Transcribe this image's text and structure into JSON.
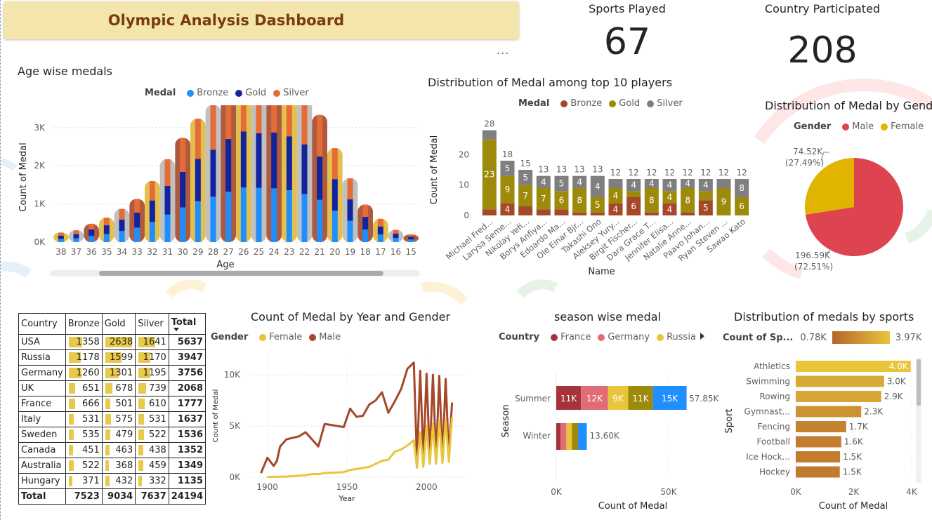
{
  "header": {
    "title": "Olympic Analysis Dashboard",
    "more_label": "..."
  },
  "kpis": [
    {
      "label": "Sports Played",
      "value": "67"
    },
    {
      "label": "Country Participated",
      "value": "208"
    }
  ],
  "colors": {
    "bronze_age": "#1f8fff",
    "gold_age": "#12239e",
    "silver_age": "#e66c37",
    "bronze": "#a5482a",
    "gold": "#9e8a0a",
    "silver": "#7f7f7f",
    "male": "#de4350",
    "female": "#e0b400",
    "line_male": "#a5482a",
    "line_female": "#e8c53a",
    "france": "#a4343a",
    "germany": "#e06c75",
    "russia": "#e8c53a"
  },
  "age_chart": {
    "title": "Age wise medals",
    "legend_title": "Medal",
    "legend": [
      "Bronze",
      "Gold",
      "Silver"
    ],
    "ylabel": "Count of Medal",
    "xlabel": "Age",
    "y_ticks": [
      "0K",
      "1K",
      "2K",
      "3K"
    ]
  },
  "players_chart": {
    "title": "Distribution of Medal among top 10 players",
    "legend_title": "Medal",
    "legend": [
      "Bronze",
      "Gold",
      "Silver"
    ],
    "ylabel": "Count of Medal",
    "xlabel": "Name",
    "y_ticks": [
      "0",
      "10",
      "20"
    ]
  },
  "gender_pie": {
    "title": "Distribution of Medal by Gender",
    "legend_title": "Gender",
    "legend": [
      "Male",
      "Female"
    ],
    "labels": [
      {
        "line1": "74.52K",
        "line2": "(27.49%)"
      },
      {
        "line1": "196.59K",
        "line2": "(72.51%)"
      }
    ]
  },
  "medal_table": {
    "headers": [
      "Country",
      "Bronze",
      "Gold",
      "Silver",
      "Total"
    ],
    "rows": [
      {
        "country": "USA",
        "bronze": "1358",
        "gold": "2638",
        "silver": "1641",
        "total": "5637"
      },
      {
        "country": "Russia",
        "bronze": "1178",
        "gold": "1599",
        "silver": "1170",
        "total": "3947"
      },
      {
        "country": "Germany",
        "bronze": "1260",
        "gold": "1301",
        "silver": "1195",
        "total": "3756"
      },
      {
        "country": "UK",
        "bronze": "651",
        "gold": "678",
        "silver": "739",
        "total": "2068"
      },
      {
        "country": "France",
        "bronze": "666",
        "gold": "501",
        "silver": "610",
        "total": "1777"
      },
      {
        "country": "Italy",
        "bronze": "531",
        "gold": "575",
        "silver": "531",
        "total": "1637"
      },
      {
        "country": "Sweden",
        "bronze": "535",
        "gold": "479",
        "silver": "522",
        "total": "1536"
      },
      {
        "country": "Canada",
        "bronze": "451",
        "gold": "463",
        "silver": "438",
        "total": "1352"
      },
      {
        "country": "Australia",
        "bronze": "522",
        "gold": "368",
        "silver": "459",
        "total": "1349"
      },
      {
        "country": "Hungary",
        "bronze": "371",
        "gold": "432",
        "silver": "332",
        "total": "1135"
      }
    ],
    "totals": {
      "label": "Total",
      "bronze": "7523",
      "gold": "9034",
      "silver": "7637",
      "total": "24194"
    }
  },
  "year_chart": {
    "title": "Count of Medal by Year and Gender",
    "legend_title": "Gender",
    "legend": [
      "Female",
      "Male"
    ],
    "ylabel": "Count of Medal",
    "xlabel": "Year",
    "y_ticks": [
      "0K",
      "5K",
      "10K"
    ],
    "x_ticks": [
      "1900",
      "1950",
      "2000"
    ]
  },
  "season_chart": {
    "title": "season wise medal",
    "legend_title": "Country",
    "legend": [
      "France",
      "Germany",
      "Russia"
    ],
    "ylabel": "Season",
    "xlabel": "Count of Medal",
    "x_ticks": [
      "0K",
      "50K"
    ]
  },
  "sports_chart": {
    "title": "Distribution of medals by sports",
    "legend_title": "Count of Sp...",
    "legend_min": "0.78K",
    "legend_max": "3.97K",
    "ylabel": "Sport",
    "xlabel": "Count of Medal",
    "x_ticks": [
      "0K",
      "2K",
      "4K"
    ]
  },
  "chart_data": [
    {
      "type": "bar",
      "title": "Age wise medals",
      "xlabel": "Age",
      "ylabel": "Count of Medal",
      "ylim": [
        0,
        3400
      ],
      "categories": [
        "38",
        "37",
        "36",
        "35",
        "34",
        "33",
        "32",
        "31",
        "30",
        "29",
        "28",
        "27",
        "26",
        "25",
        "24",
        "23",
        "22",
        "21",
        "20",
        "19",
        "18",
        "17",
        "16",
        "15"
      ],
      "series": [
        {
          "name": "Bronze",
          "values": [
            80,
            100,
            160,
            210,
            290,
            380,
            530,
            720,
            910,
            1070,
            1190,
            1320,
            1430,
            1420,
            1410,
            1360,
            1260,
            1110,
            820,
            560,
            330,
            200,
            110,
            70
          ]
        },
        {
          "name": "Gold",
          "values": [
            90,
            110,
            170,
            230,
            300,
            390,
            560,
            750,
            930,
            1110,
            1230,
            1380,
            1470,
            1430,
            1460,
            1410,
            1300,
            1130,
            830,
            560,
            330,
            210,
            110,
            70
          ]
        },
        {
          "name": "Silver",
          "values": [
            80,
            100,
            150,
            200,
            280,
            360,
            510,
            700,
            890,
            1050,
            1170,
            1300,
            1400,
            1380,
            1390,
            1330,
            1240,
            1090,
            810,
            550,
            320,
            200,
            100,
            60
          ]
        }
      ]
    },
    {
      "type": "bar",
      "title": "Distribution of Medal among top 10 players",
      "xlabel": "Name",
      "ylabel": "Count of Medal",
      "categories": [
        "Michael Fred...",
        "Larysa Seme...",
        "Nikolay Yefi...",
        "Borys Anfiya...",
        "Edoardo Ma...",
        "Ole Einar Bjr...",
        "Takashi Ono",
        "Aleksey Yury...",
        "Birgit Fischer...",
        "Dara Grace T...",
        "Jennifer Elisa...",
        "Natalie Anne...",
        "Paavo Johan...",
        "Ryan Steven ...",
        "Sawao Kato"
      ],
      "totals": [
        28,
        18,
        15,
        13,
        13,
        13,
        13,
        12,
        12,
        12,
        12,
        12,
        12,
        12,
        12
      ],
      "series": [
        {
          "name": "Bronze",
          "values": [
            2,
            4,
            3,
            2,
            2,
            1,
            1,
            4,
            6,
            1,
            4,
            1,
            5,
            0,
            0
          ]
        },
        {
          "name": "Gold",
          "values": [
            23,
            9,
            7,
            7,
            6,
            8,
            5,
            5,
            2,
            8,
            4,
            8,
            3,
            9,
            6
          ]
        },
        {
          "name": "Silver",
          "values": [
            3,
            5,
            5,
            4,
            5,
            4,
            7,
            3,
            4,
            3,
            4,
            3,
            4,
            3,
            6
          ]
        }
      ],
      "labels_shown": [
        {
          "bronze": "",
          "gold": "23",
          "silver": ""
        },
        {
          "bronze": "4",
          "gold": "9",
          "silver": "5"
        },
        {
          "bronze": "",
          "gold": "7",
          "silver": "5"
        },
        {
          "bronze": "",
          "gold": "7",
          "silver": "4"
        },
        {
          "bronze": "",
          "gold": "6",
          "silver": "5"
        },
        {
          "bronze": "",
          "gold": "8",
          "silver": "4"
        },
        {
          "bronze": "",
          "gold": "5",
          "silver": "4"
        },
        {
          "bronze": "4",
          "gold": "4",
          "silver": ""
        },
        {
          "bronze": "6",
          "gold": "",
          "silver": "4"
        },
        {
          "bronze": "",
          "gold": "8",
          "silver": "4"
        },
        {
          "bronze": "4",
          "gold": "4",
          "silver": "4"
        },
        {
          "bronze": "",
          "gold": "8",
          "silver": "4"
        },
        {
          "bronze": "5",
          "gold": "",
          "silver": "4"
        },
        {
          "bronze": "",
          "gold": "9",
          "silver": ""
        },
        {
          "bronze": "",
          "gold": "6",
          "silver": "8"
        }
      ]
    },
    {
      "type": "pie",
      "title": "Distribution of Medal by Gender",
      "categories": [
        "Male",
        "Female"
      ],
      "values": [
        196590,
        74520
      ]
    },
    {
      "type": "line",
      "title": "Count of Medal by Year and Gender",
      "xlabel": "Year",
      "ylabel": "Count of Medal",
      "ylim": [
        0,
        12000
      ],
      "series": [
        {
          "name": "Male",
          "x": [
            1896,
            1900,
            1904,
            1906,
            1908,
            1912,
            1920,
            1924,
            1928,
            1932,
            1936,
            1948,
            1952,
            1956,
            1960,
            1964,
            1968,
            1972,
            1976,
            1980,
            1984,
            1988,
            1992,
            1994,
            1996,
            1998,
            2000,
            2002,
            2004,
            2006,
            2008,
            2010,
            2012,
            2014,
            2016
          ],
          "y": [
            400,
            1900,
            1100,
            1600,
            3000,
            3700,
            4000,
            4400,
            3700,
            3000,
            5200,
            4900,
            6700,
            5900,
            6000,
            7100,
            7500,
            8300,
            6300,
            7400,
            8600,
            10600,
            11200,
            1500,
            10400,
            1800,
            10100,
            1900,
            10000,
            1900,
            9900,
            1900,
            9600,
            2000,
            7300
          ]
        },
        {
          "name": "Female",
          "x": [
            1900,
            1912,
            1920,
            1924,
            1928,
            1932,
            1936,
            1948,
            1952,
            1956,
            1960,
            1964,
            1968,
            1972,
            1976,
            1980,
            1984,
            1988,
            1992,
            1994,
            1996,
            1998,
            2000,
            2002,
            2004,
            2006,
            2008,
            2010,
            2012,
            2014,
            2016
          ],
          "y": [
            30,
            60,
            150,
            200,
            300,
            300,
            400,
            500,
            700,
            800,
            900,
            1000,
            1300,
            1600,
            1700,
            2500,
            2700,
            3100,
            3600,
            900,
            4400,
            1000,
            5000,
            1300,
            5200,
            1300,
            5500,
            1400,
            5600,
            1500,
            5900
          ]
        }
      ]
    },
    {
      "type": "bar",
      "title": "season wise medal",
      "xlabel": "Count of Medal",
      "ylabel": "Season",
      "categories": [
        "Summer",
        "Winter"
      ],
      "totals_labels": [
        "57.85K",
        "13.60K"
      ],
      "totals": [
        57850,
        13600
      ],
      "segment_colors": [
        "#a4343a",
        "#e06c75",
        "#e8c53a",
        "#9e8a0a",
        "#1f8fff"
      ],
      "segments": [
        {
          "values": [
            11000,
            12000,
            9000,
            11000,
            15000
          ],
          "labels": [
            "11K",
            "12K",
            "9K",
            "11K",
            "15K"
          ]
        },
        {
          "values": [
            1900,
            2600,
            2500,
            2700,
            3900
          ],
          "labels": [
            "",
            "",
            "",
            "",
            ""
          ]
        }
      ]
    },
    {
      "type": "bar",
      "title": "Distribution of medals by sports",
      "xlabel": "Count of Medal",
      "ylabel": "Sport",
      "xlim": [
        0,
        4000
      ],
      "categories": [
        "Athletics",
        "Swimming",
        "Rowing",
        "Gymnast...",
        "Fencing",
        "Football",
        "Ice Hock...",
        "Hockey"
      ],
      "values": [
        3970,
        3050,
        2950,
        2260,
        1740,
        1570,
        1530,
        1520
      ],
      "labels": [
        "4.0K",
        "3.0K",
        "2.9K",
        "2.3K",
        "1.7K",
        "1.6K",
        "1.5K",
        "1.5K"
      ]
    }
  ]
}
